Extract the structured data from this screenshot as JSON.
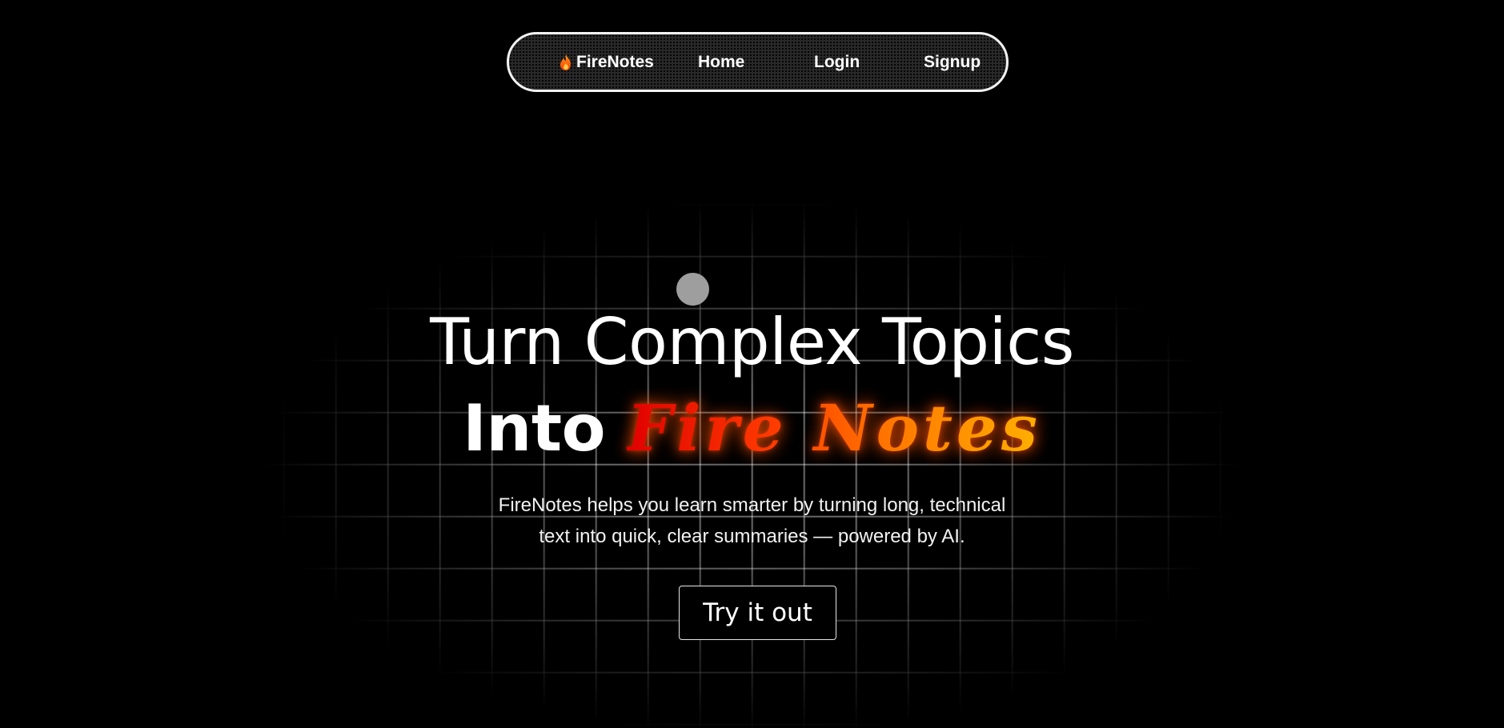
{
  "navbar": {
    "brand": "FireNotes",
    "brand_icon": "fire-icon",
    "items": [
      {
        "label": "Home"
      },
      {
        "label": "Login"
      },
      {
        "label": "Signup"
      }
    ]
  },
  "hero": {
    "line1": "Turn Complex Topics",
    "line2_prefix": "Into",
    "line2_highlight": "Fire Notes",
    "subtitle_line1": "FireNotes helps you learn smarter by turning long, technical",
    "subtitle_line2": "text into quick, clear summaries — powered by AI.",
    "cta_label": "Try it out"
  },
  "colors": {
    "background": "#000000",
    "highlight_start": "#e00000",
    "highlight_end": "#ffb000",
    "dot": "#9e9e9e"
  }
}
